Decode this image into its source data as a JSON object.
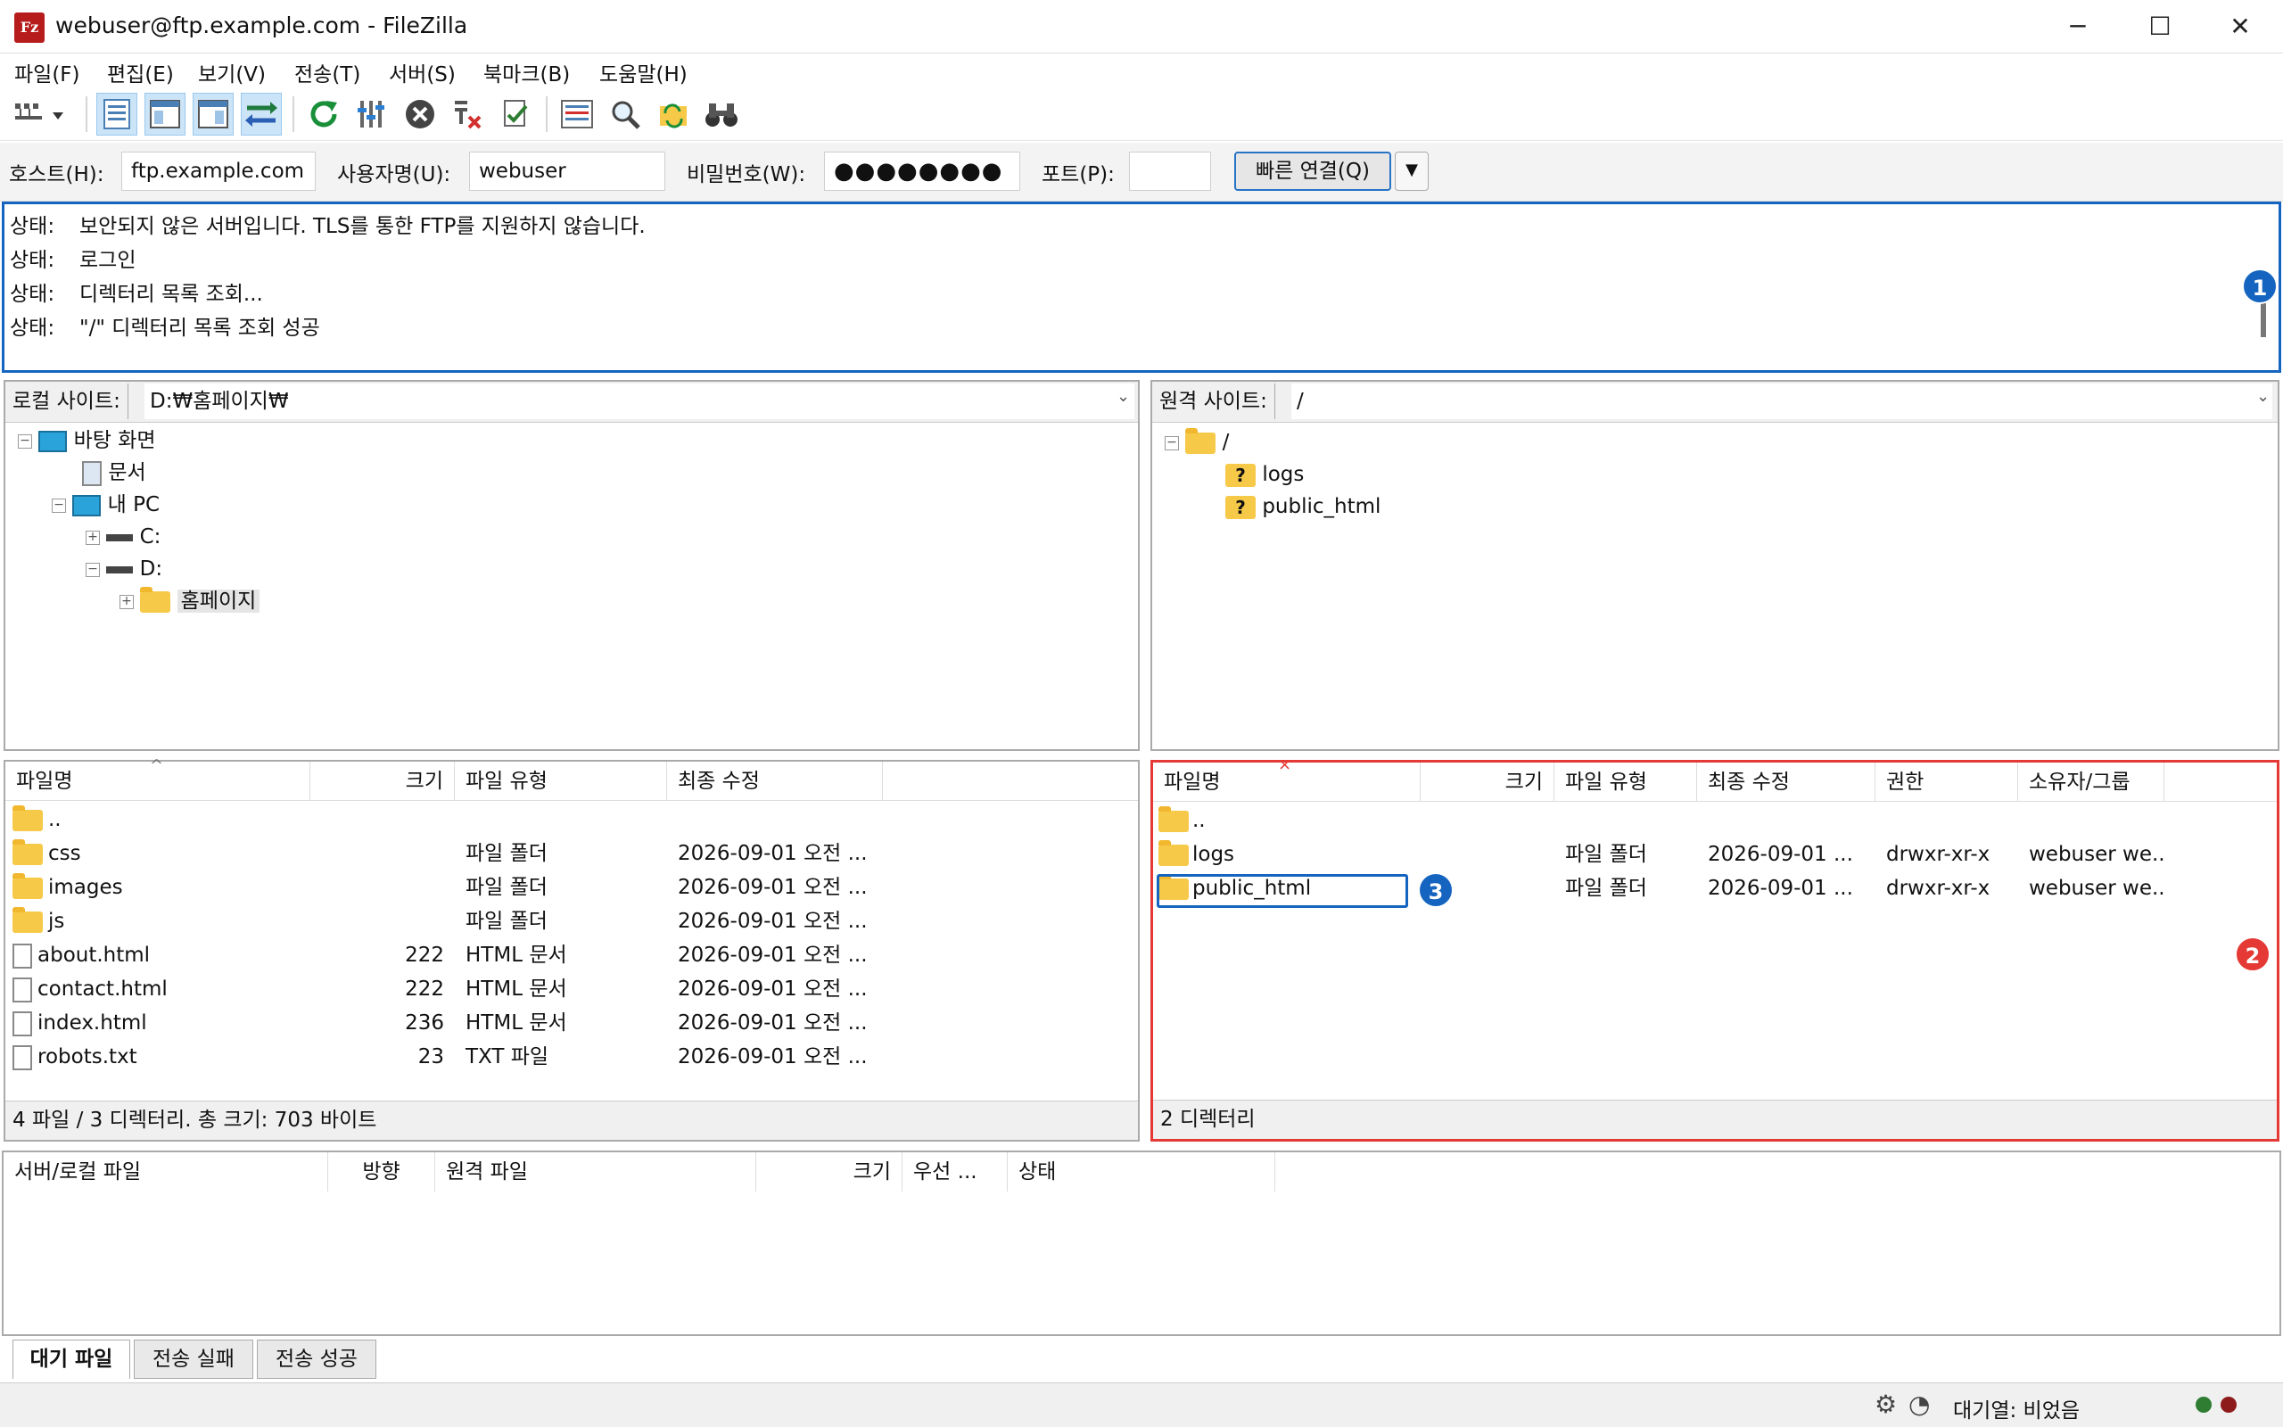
{
  "window": {
    "title": "webuser@ftp.example.com - FileZilla",
    "app_icon_letter": "Fz"
  },
  "menu": [
    "파일(F)",
    "편집(E)",
    "보기(V)",
    "전송(T)",
    "서버(S)",
    "북마크(B)",
    "도움말(H)"
  ],
  "quickconnect": {
    "host_label": "호스트(H):",
    "host_value": "ftp.example.com",
    "user_label": "사용자명(U):",
    "user_value": "webuser",
    "pass_label": "비밀번호(W):",
    "pass_value": "●●●●●●●●",
    "port_label": "포트(P):",
    "port_value": "",
    "connect_label": "빠른 연결(Q)"
  },
  "log": {
    "prefix": "상태:",
    "lines": [
      "보안되지 않은 서버입니다. TLS를 통한 FTP를 지원하지 않습니다.",
      "로그인",
      "디렉터리 목록 조회...",
      "\"/\" 디렉터리 목록 조회 성공"
    ]
  },
  "badges": {
    "one": "1",
    "two": "2",
    "three": "3"
  },
  "local": {
    "site_label": "로컬 사이트:",
    "path": "D:₩홈페이지₩",
    "tree": {
      "desktop": "바탕 화면",
      "documents": "문서",
      "mypc": "내 PC",
      "c": "C:",
      "d": "D:",
      "homepage": "홈페이지"
    },
    "headers": {
      "name": "파일명",
      "size": "크기",
      "type": "파일 유형",
      "modified": "최종 수정"
    },
    "files": [
      {
        "name": "..",
        "size": "",
        "type": "",
        "modified": ""
      },
      {
        "name": "css",
        "size": "",
        "type": "파일 폴더",
        "modified": "2026-09-01 오전 ..."
      },
      {
        "name": "images",
        "size": "",
        "type": "파일 폴더",
        "modified": "2026-09-01 오전 ..."
      },
      {
        "name": "js",
        "size": "",
        "type": "파일 폴더",
        "modified": "2026-09-01 오전 ..."
      },
      {
        "name": "about.html",
        "size": "222",
        "type": "HTML 문서",
        "modified": "2026-09-01 오전 ..."
      },
      {
        "name": "contact.html",
        "size": "222",
        "type": "HTML 문서",
        "modified": "2026-09-01 오전 ..."
      },
      {
        "name": "index.html",
        "size": "236",
        "type": "HTML 문서",
        "modified": "2026-09-01 오전 ..."
      },
      {
        "name": "robots.txt",
        "size": "23",
        "type": "TXT 파일",
        "modified": "2026-09-01 오전 ..."
      }
    ],
    "status": "4 파일 / 3 디렉터리. 총 크기: 703 바이트"
  },
  "remote": {
    "site_label": "원격 사이트:",
    "path": "/",
    "tree": {
      "root": "/",
      "logs": "logs",
      "public_html": "public_html"
    },
    "headers": {
      "name": "파일명",
      "size": "크기",
      "type": "파일 유형",
      "modified": "최종 수정",
      "perm": "권한",
      "owner": "소유자/그룹"
    },
    "files": [
      {
        "name": "..",
        "type": "",
        "modified": "",
        "perm": "",
        "owner": ""
      },
      {
        "name": "logs",
        "type": "파일 폴더",
        "modified": "2026-09-01 ...",
        "perm": "drwxr-xr-x",
        "owner": "webuser we..."
      },
      {
        "name": "public_html",
        "type": "파일 폴더",
        "modified": "2026-09-01 ...",
        "perm": "drwxr-xr-x",
        "owner": "webuser we..."
      }
    ],
    "status": "2 디렉터리"
  },
  "queue": {
    "headers": {
      "local": "서버/로컬 파일",
      "direction": "방향",
      "remote": "원격 파일",
      "size": "크기",
      "priority": "우선 ...",
      "status": "상태"
    },
    "tabs": [
      "대기 파일",
      "전송 실패",
      "전송 성공"
    ],
    "status_text": "대기열: 비었음"
  },
  "colors": {
    "badge_blue": "#1565c0",
    "badge_red": "#e53935",
    "highlight_red": "#e53935"
  }
}
